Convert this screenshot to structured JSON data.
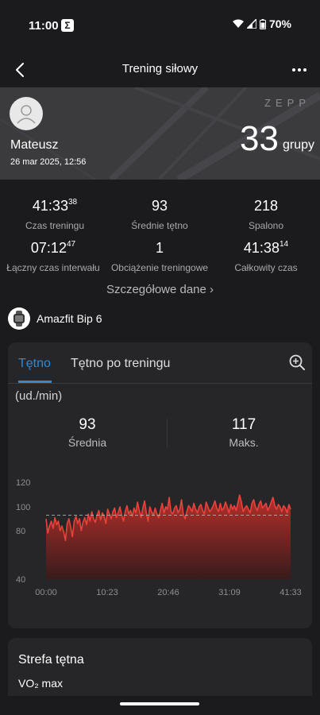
{
  "status_bar": {
    "time": "11:00",
    "app_icon": "Σ",
    "battery": "70%",
    "icons": [
      "wifi-icon",
      "signal-icon",
      "battery-icon"
    ]
  },
  "nav": {
    "title": "Trening siłowy",
    "back_icon": "back-arrow-icon",
    "more_icon": "more-dots-icon"
  },
  "hero": {
    "name": "Mateusz",
    "date": "26 mar 2025, 12:56",
    "logo": "ZEPP",
    "count": "33",
    "unit": "grupy"
  },
  "stats": [
    {
      "value": "41:33",
      "sup": "38",
      "label": "Czas treningu"
    },
    {
      "value": "93",
      "sup": "",
      "label": "Średnie tętno"
    },
    {
      "value": "218",
      "sup": "",
      "label": "Spalono"
    },
    {
      "value": "07:12",
      "sup": "47",
      "label": "Łączny czas interwału"
    },
    {
      "value": "1",
      "sup": "",
      "label": "Obciążenie treningowe"
    },
    {
      "value": "41:38",
      "sup": "14",
      "label": "Całkowity czas"
    }
  ],
  "details_link": "Szczegółowe dane ›",
  "device": {
    "name": "Amazfit Bip 6"
  },
  "hr_card": {
    "tabs": [
      "Tętno",
      "Tętno po treningu"
    ],
    "unit": "(ud./min)",
    "average": {
      "value": "93",
      "label": "Średnia"
    },
    "max": {
      "value": "117",
      "label": "Maks."
    }
  },
  "chart_data": {
    "type": "area",
    "y_ticks": [
      "120",
      "100",
      "80",
      "40"
    ],
    "x_ticks": [
      "00:00",
      "10:23",
      "20:46",
      "31:09",
      "41:33"
    ],
    "ylim": [
      40,
      120
    ],
    "xlim_minutes": [
      0,
      41.55
    ],
    "average_line": 93,
    "line_color": "#e8423c",
    "series": [
      {
        "values": [
          90,
          78,
          84,
          88,
          82,
          91,
          85,
          88,
          80,
          84,
          79,
          72,
          86,
          90,
          83,
          75,
          88,
          92,
          86,
          90,
          80,
          87,
          91,
          85,
          94,
          88,
          96,
          90,
          87,
          93,
          97,
          89,
          95,
          92,
          86,
          98,
          94,
          90,
          96,
          99,
          91,
          95,
          100,
          93,
          88,
          96,
          101,
          94,
          97,
          92,
          99,
          95,
          104,
          97,
          91,
          99,
          105,
          95,
          88,
          100,
          96,
          93,
          99,
          94,
          91,
          97,
          103,
          95,
          100,
          98,
          108,
          96,
          94,
          99,
          101,
          95,
          98,
          106,
          94,
          90,
          96,
          101,
          99,
          96,
          103,
          98,
          95,
          100,
          102,
          97,
          94,
          104,
          100,
          96,
          98,
          101,
          105,
          99,
          96,
          103,
          97,
          99,
          104,
          100,
          95,
          102,
          98,
          101,
          97,
          103,
          110,
          104,
          96,
          99,
          101,
          98,
          95,
          103,
          106,
          100,
          97,
          102,
          105,
          99,
          101,
          103,
          97,
          100,
          104,
          108,
          101,
          98,
          102,
          100,
          96,
          101,
          99,
          95,
          102,
          98
        ]
      }
    ]
  },
  "zone_card": {
    "title": "Strefa tętna",
    "subtitle": "VO₂ max"
  }
}
